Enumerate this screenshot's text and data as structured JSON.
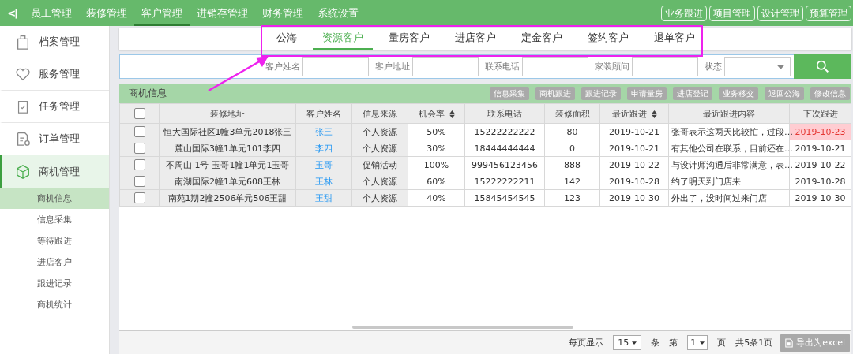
{
  "top_nav": {
    "collapse_icon": "<|",
    "items": [
      {
        "label": "员工管理",
        "selected": false
      },
      {
        "label": "装修管理",
        "selected": false
      },
      {
        "label": "客户管理",
        "selected": true
      },
      {
        "label": "进销存管理",
        "selected": false
      },
      {
        "label": "财务管理",
        "selected": false
      },
      {
        "label": "系统设置",
        "selected": false
      }
    ],
    "quick_buttons": [
      "业务跟进",
      "项目管理",
      "设计管理",
      "预算管理"
    ]
  },
  "sidebar": {
    "items": [
      {
        "label": "档案管理",
        "expanded": false
      },
      {
        "label": "服务管理",
        "expanded": false
      },
      {
        "label": "任务管理",
        "expanded": false
      },
      {
        "label": "订单管理",
        "expanded": false
      },
      {
        "label": "商机管理",
        "expanded": true,
        "children": [
          {
            "label": "商机信息",
            "selected": true
          },
          {
            "label": "信息采集",
            "selected": false
          },
          {
            "label": "等待跟进",
            "selected": false
          },
          {
            "label": "进店客户",
            "selected": false
          },
          {
            "label": "跟进记录",
            "selected": false
          },
          {
            "label": "商机统计",
            "selected": false
          }
        ]
      }
    ]
  },
  "tabs": [
    {
      "label": "公海",
      "selected": false
    },
    {
      "label": "资源客户",
      "selected": true
    },
    {
      "label": "量房客户",
      "selected": false
    },
    {
      "label": "进店客户",
      "selected": false
    },
    {
      "label": "定金客户",
      "selected": false
    },
    {
      "label": "签约客户",
      "selected": false
    },
    {
      "label": "退单客户",
      "selected": false
    }
  ],
  "search": {
    "fields": [
      {
        "label": "客户姓名",
        "kind": "text"
      },
      {
        "label": "客户地址",
        "kind": "text"
      },
      {
        "label": "联系电话",
        "kind": "text"
      },
      {
        "label": "家装顾问",
        "kind": "text"
      },
      {
        "label": "状态",
        "kind": "select"
      }
    ]
  },
  "panel": {
    "title": "商机信息",
    "actions": [
      "信息采集",
      "商机跟进",
      "跟进记录",
      "申请量房",
      "进店登记",
      "业务移交",
      "退回公海",
      "修改信息"
    ]
  },
  "table": {
    "all_checked": false,
    "columns": [
      {
        "label": "装修地址",
        "sortable": false
      },
      {
        "label": "客户姓名",
        "sortable": false
      },
      {
        "label": "信息来源",
        "sortable": false
      },
      {
        "label": "机会率",
        "sortable": true
      },
      {
        "label": "联系电话",
        "sortable": false
      },
      {
        "label": "装修面积",
        "sortable": false
      },
      {
        "label": "最近跟进",
        "sortable": true
      },
      {
        "label": "最近跟进内容",
        "sortable": false
      },
      {
        "label": "下次跟进",
        "sortable": false
      }
    ],
    "rows": [
      {
        "checked": false,
        "overdue": true,
        "cells": [
          "恒大国际社区1幢3单元2018张三",
          "张三",
          "个人资源",
          "50%",
          "15222222222",
          "80",
          "2019-10-21",
          "张哥表示这两天比较忙，过段…",
          "2019-10-23"
        ]
      },
      {
        "checked": false,
        "overdue": false,
        "cells": [
          "麓山国际3幢1单元101李四",
          "李四",
          "个人资源",
          "30%",
          "18444444444",
          "0",
          "2019-10-21",
          "有其他公司在联系，目前还在…",
          "2019-10-21"
        ]
      },
      {
        "checked": false,
        "overdue": false,
        "cells": [
          "不周山-1号-玉哥1幢1单元1玉哥",
          "玉哥",
          "促销活动",
          "100%",
          "999456123456",
          "888",
          "2019-10-22",
          "与设计师沟通后非常满意，表…",
          "2019-10-22"
        ]
      },
      {
        "checked": false,
        "overdue": false,
        "cells": [
          "南湖国际2幢1单元608王林",
          "王林",
          "个人资源",
          "60%",
          "15222222211",
          "142",
          "2019-10-28",
          "约了明天到门店来",
          "2019-10-28"
        ]
      },
      {
        "checked": false,
        "overdue": false,
        "cells": [
          "南苑1期2幢2506单元506王甜",
          "王甜",
          "个人资源",
          "40%",
          "15845454545",
          "123",
          "2019-10-30",
          "外出了，没时间过来门店",
          "2019-10-30"
        ]
      }
    ]
  },
  "pagination": {
    "per_page_label": "每页显示",
    "per_page": "15",
    "unit": "条",
    "page_label": "第",
    "page": "1",
    "page_unit": "页",
    "summary": "共5条1页",
    "export_button": "导出为excel"
  }
}
